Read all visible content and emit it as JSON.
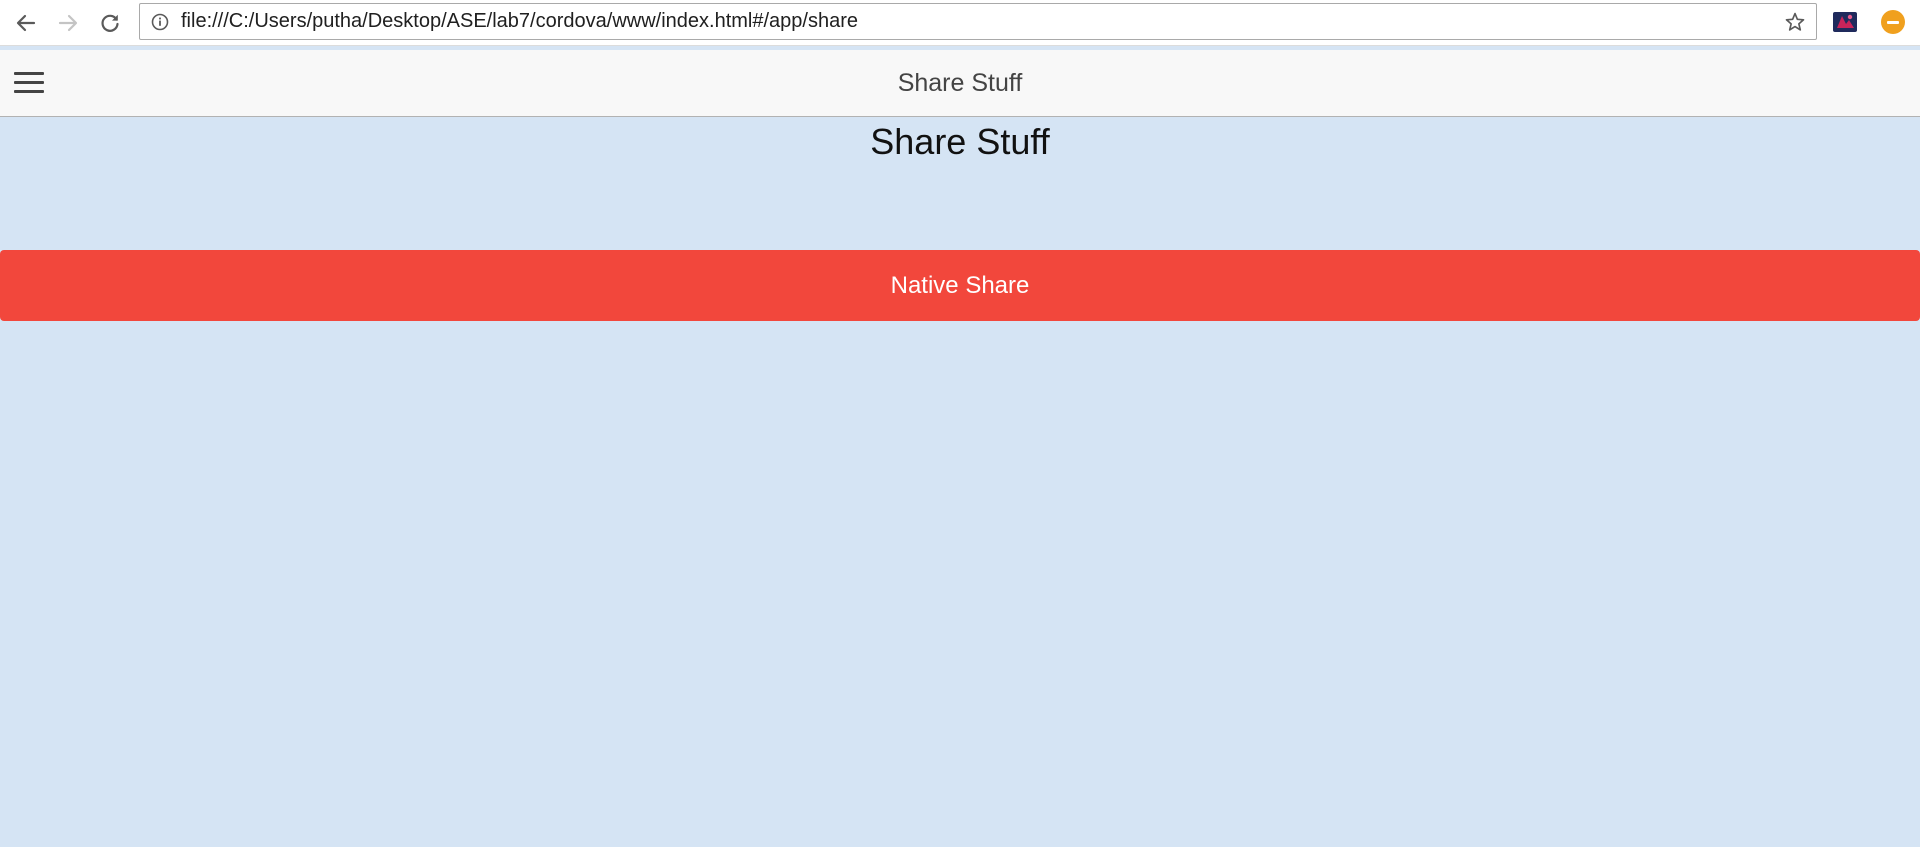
{
  "browser": {
    "url": "file:///C:/Users/putha/Desktop/ASE/lab7/cordova/www/index.html#/app/share",
    "icons": {
      "back": "arrow-left-icon",
      "forward": "arrow-right-icon",
      "reload": "reload-icon",
      "info": "info-icon",
      "bookmark": "star-icon",
      "extension": "extension-icon",
      "badge": "minus-badge-icon"
    }
  },
  "header": {
    "title": "Share Stuff",
    "menu_icon": "hamburger-icon"
  },
  "main": {
    "heading": "Share Stuff",
    "share_button_label": "Native Share"
  },
  "colors": {
    "page_background": "#d5e4f4",
    "header_background": "#f8f8f8",
    "button_background": "#f2473c",
    "button_text": "#ffffff",
    "badge": "#f0a01e"
  }
}
